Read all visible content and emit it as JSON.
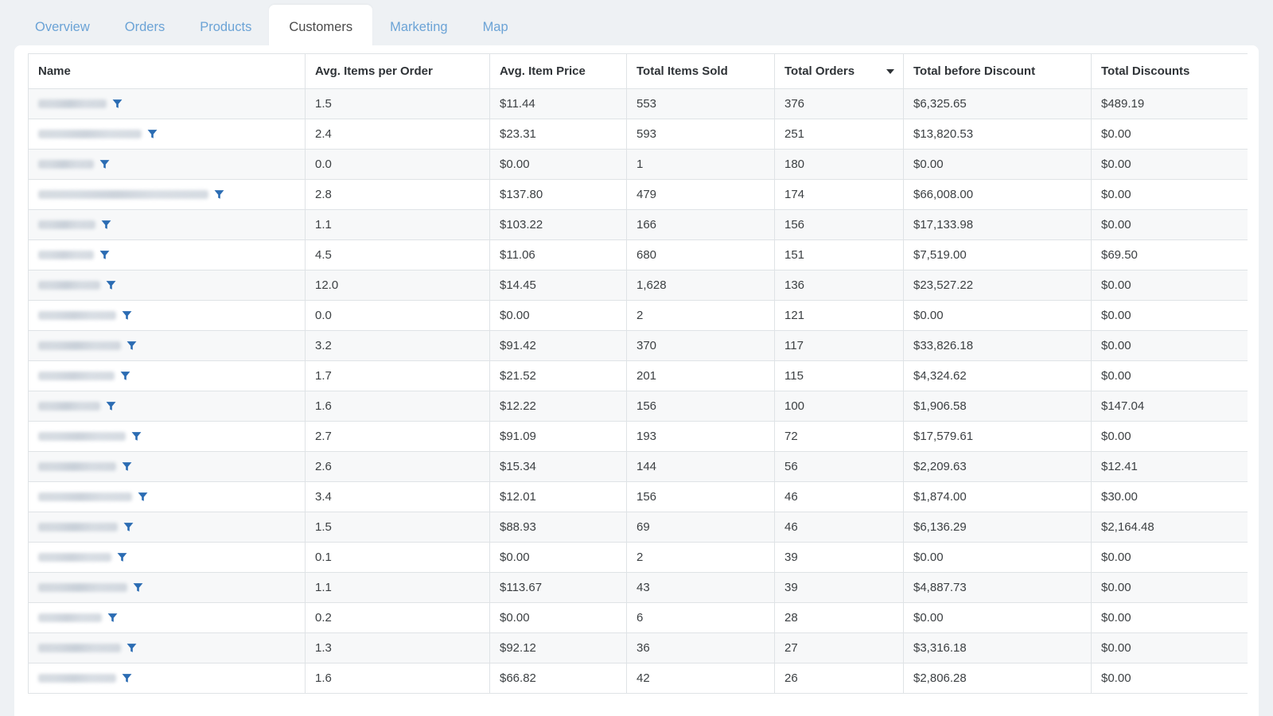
{
  "tabs": [
    {
      "label": "Overview",
      "active": false
    },
    {
      "label": "Orders",
      "active": false
    },
    {
      "label": "Products",
      "active": false
    },
    {
      "label": "Customers",
      "active": true
    },
    {
      "label": "Marketing",
      "active": false
    },
    {
      "label": "Map",
      "active": false
    }
  ],
  "table": {
    "sort": {
      "column": "Total Orders",
      "direction": "descending",
      "indicator": "triangle-down"
    },
    "columns": [
      {
        "key": "name",
        "label": "Name",
        "sorted": false
      },
      {
        "key": "avg_items_per_order",
        "label": "Avg. Items per Order",
        "sorted": false
      },
      {
        "key": "avg_item_price",
        "label": "Avg. Item Price",
        "sorted": false
      },
      {
        "key": "total_items_sold",
        "label": "Total Items Sold",
        "sorted": false
      },
      {
        "key": "total_orders",
        "label": "Total Orders",
        "sorted": true
      },
      {
        "key": "total_before_discount",
        "label": "Total before Discount",
        "sorted": false
      },
      {
        "key": "total_discounts",
        "label": "Total Discounts",
        "sorted": false
      }
    ],
    "name_cell_icon": "filter-funnel-icon",
    "name_cell_state": "redacted",
    "rows": [
      {
        "name_width": 86,
        "avg_items_per_order": "1.5",
        "avg_item_price": "$11.44",
        "total_items_sold": "553",
        "total_orders": "376",
        "total_before_discount": "$6,325.65",
        "total_discounts": "$489.19"
      },
      {
        "name_width": 130,
        "avg_items_per_order": "2.4",
        "avg_item_price": "$23.31",
        "total_items_sold": "593",
        "total_orders": "251",
        "total_before_discount": "$13,820.53",
        "total_discounts": "$0.00"
      },
      {
        "name_width": 70,
        "avg_items_per_order": "0.0",
        "avg_item_price": "$0.00",
        "total_items_sold": "1",
        "total_orders": "180",
        "total_before_discount": "$0.00",
        "total_discounts": "$0.00"
      },
      {
        "name_width": 214,
        "avg_items_per_order": "2.8",
        "avg_item_price": "$137.80",
        "total_items_sold": "479",
        "total_orders": "174",
        "total_before_discount": "$66,008.00",
        "total_discounts": "$0.00"
      },
      {
        "name_width": 72,
        "avg_items_per_order": "1.1",
        "avg_item_price": "$103.22",
        "total_items_sold": "166",
        "total_orders": "156",
        "total_before_discount": "$17,133.98",
        "total_discounts": "$0.00"
      },
      {
        "name_width": 70,
        "avg_items_per_order": "4.5",
        "avg_item_price": "$11.06",
        "total_items_sold": "680",
        "total_orders": "151",
        "total_before_discount": "$7,519.00",
        "total_discounts": "$69.50"
      },
      {
        "name_width": 78,
        "avg_items_per_order": "12.0",
        "avg_item_price": "$14.45",
        "total_items_sold": "1,628",
        "total_orders": "136",
        "total_before_discount": "$23,527.22",
        "total_discounts": "$0.00"
      },
      {
        "name_width": 98,
        "avg_items_per_order": "0.0",
        "avg_item_price": "$0.00",
        "total_items_sold": "2",
        "total_orders": "121",
        "total_before_discount": "$0.00",
        "total_discounts": "$0.00"
      },
      {
        "name_width": 104,
        "avg_items_per_order": "3.2",
        "avg_item_price": "$91.42",
        "total_items_sold": "370",
        "total_orders": "117",
        "total_before_discount": "$33,826.18",
        "total_discounts": "$0.00"
      },
      {
        "name_width": 96,
        "avg_items_per_order": "1.7",
        "avg_item_price": "$21.52",
        "total_items_sold": "201",
        "total_orders": "115",
        "total_before_discount": "$4,324.62",
        "total_discounts": "$0.00"
      },
      {
        "name_width": 78,
        "avg_items_per_order": "1.6",
        "avg_item_price": "$12.22",
        "total_items_sold": "156",
        "total_orders": "100",
        "total_before_discount": "$1,906.58",
        "total_discounts": "$147.04"
      },
      {
        "name_width": 110,
        "avg_items_per_order": "2.7",
        "avg_item_price": "$91.09",
        "total_items_sold": "193",
        "total_orders": "72",
        "total_before_discount": "$17,579.61",
        "total_discounts": "$0.00"
      },
      {
        "name_width": 98,
        "avg_items_per_order": "2.6",
        "avg_item_price": "$15.34",
        "total_items_sold": "144",
        "total_orders": "56",
        "total_before_discount": "$2,209.63",
        "total_discounts": "$12.41"
      },
      {
        "name_width": 118,
        "avg_items_per_order": "3.4",
        "avg_item_price": "$12.01",
        "total_items_sold": "156",
        "total_orders": "46",
        "total_before_discount": "$1,874.00",
        "total_discounts": "$30.00"
      },
      {
        "name_width": 100,
        "avg_items_per_order": "1.5",
        "avg_item_price": "$88.93",
        "total_items_sold": "69",
        "total_orders": "46",
        "total_before_discount": "$6,136.29",
        "total_discounts": "$2,164.48"
      },
      {
        "name_width": 92,
        "avg_items_per_order": "0.1",
        "avg_item_price": "$0.00",
        "total_items_sold": "2",
        "total_orders": "39",
        "total_before_discount": "$0.00",
        "total_discounts": "$0.00"
      },
      {
        "name_width": 112,
        "avg_items_per_order": "1.1",
        "avg_item_price": "$113.67",
        "total_items_sold": "43",
        "total_orders": "39",
        "total_before_discount": "$4,887.73",
        "total_discounts": "$0.00"
      },
      {
        "name_width": 80,
        "avg_items_per_order": "0.2",
        "avg_item_price": "$0.00",
        "total_items_sold": "6",
        "total_orders": "28",
        "total_before_discount": "$0.00",
        "total_discounts": "$0.00"
      },
      {
        "name_width": 104,
        "avg_items_per_order": "1.3",
        "avg_item_price": "$92.12",
        "total_items_sold": "36",
        "total_orders": "27",
        "total_before_discount": "$3,316.18",
        "total_discounts": "$0.00"
      },
      {
        "name_width": 98,
        "avg_items_per_order": "1.6",
        "avg_item_price": "$66.82",
        "total_items_sold": "42",
        "total_orders": "26",
        "total_before_discount": "$2,806.28",
        "total_discounts": "$0.00"
      }
    ]
  },
  "colors": {
    "page_background": "#eef1f4",
    "card_background": "#ffffff",
    "tab_inactive": "#6ba3d6",
    "tab_active_text": "#4a4a4a",
    "grid_border": "#dfe3e6",
    "row_stripe": "#f7f8f9",
    "filter_icon": "#2b6cb3",
    "text": "#3c4043"
  }
}
